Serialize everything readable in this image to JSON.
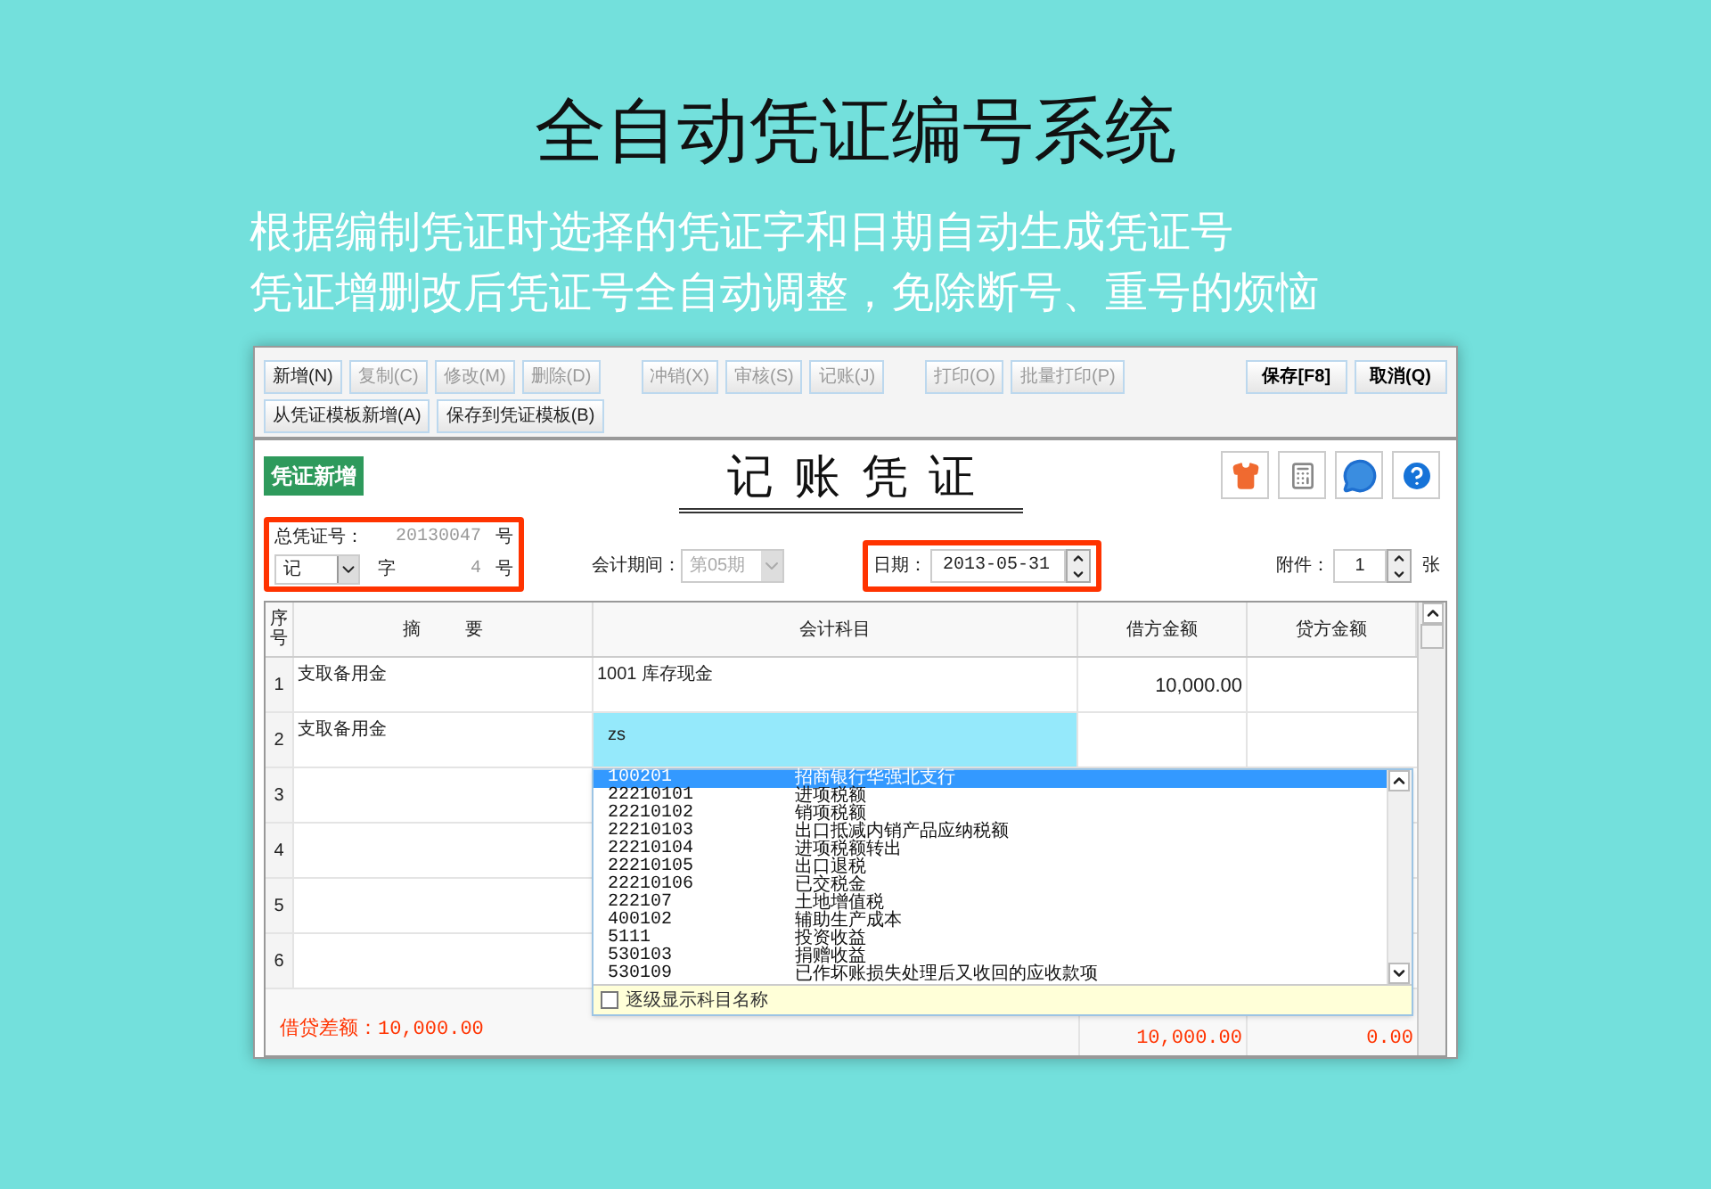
{
  "headline": "全自动凭证编号系统",
  "subtitle_lines": [
    "根据编制凭证时选择的凭证字和日期自动生成凭证号",
    "凭证增删改后凭证号全自动调整，免除断号、重号的烦恼"
  ],
  "toolbar": {
    "groups": [
      [
        {
          "label": "新增(N)",
          "disabled": false
        },
        {
          "label": "复制(C)",
          "disabled": true
        },
        {
          "label": "修改(M)",
          "disabled": true
        },
        {
          "label": "删除(D)",
          "disabled": true
        }
      ],
      [
        {
          "label": "冲销(X)",
          "disabled": true
        },
        {
          "label": "审核(S)",
          "disabled": true
        },
        {
          "label": "记账(J)",
          "disabled": true
        }
      ],
      [
        {
          "label": "打印(O)",
          "disabled": true
        },
        {
          "label": "批量打印(P)",
          "disabled": true
        }
      ]
    ],
    "right_buttons": [
      "保存[F8]",
      "取消(Q)"
    ],
    "second_row": [
      {
        "label": "从凭证模板新增(A)",
        "disabled": false
      },
      {
        "label": "保存到凭证模板(B)",
        "disabled": false
      }
    ]
  },
  "voucher": {
    "badge": "凭证新增",
    "title": "记账凭证",
    "total_no_label": "总凭证号：",
    "total_no": "20130047",
    "total_no_suffix": "号",
    "word": "记",
    "word_label": "字",
    "number": "4",
    "number_suffix": "号",
    "period_label": "会计期间：",
    "period": "第05期",
    "period_disabled": true,
    "date_label": "日期：",
    "date": "2013-05-31",
    "attach_label": "附件：",
    "attach": "1",
    "attach_suffix": "张"
  },
  "table": {
    "columns": [
      "序号",
      "摘要",
      "会计科目",
      "借方金额",
      "贷方金额"
    ],
    "rows": [
      {
        "index": "1",
        "summary": "支取备用金",
        "account": "1001 库存现金",
        "debit": "10,000.00",
        "kind": "entry"
      },
      {
        "index": "2",
        "summary": "支取备用金",
        "account": "zs",
        "kind": "input"
      },
      {
        "index": "3",
        "kind": "entry"
      },
      {
        "index": "4",
        "kind": "entry"
      },
      {
        "index": "5",
        "kind": "entry"
      },
      {
        "index": "6",
        "kind": "entry"
      }
    ],
    "difference": "借贷差额：10,000.00",
    "debit_total": "10,000.00",
    "credit_total": "0.00"
  },
  "dropdown": {
    "items": [
      {
        "code": "100201",
        "name": "招商银行华强北支行",
        "selected": true
      },
      {
        "code": "22210101",
        "name": "进项税额",
        "selected": false
      },
      {
        "code": "22210102",
        "name": "销项税额",
        "selected": false
      },
      {
        "code": "22210103",
        "name": "出口抵减内销产品应纳税额",
        "selected": false
      },
      {
        "code": "22210104",
        "name": "进项税额转出",
        "selected": false
      },
      {
        "code": "22210105",
        "name": "出口退税",
        "selected": false
      },
      {
        "code": "22210106",
        "name": "已交税金",
        "selected": false
      },
      {
        "code": "222107",
        "name": "土地增值税",
        "selected": false
      },
      {
        "code": "400102",
        "name": "辅助生产成本",
        "selected": false
      },
      {
        "code": "5111",
        "name": "投资收益",
        "selected": false
      },
      {
        "code": "530103",
        "name": "捐赠收益",
        "selected": false
      },
      {
        "code": "530109",
        "name": "已作坏账损失处理后又收回的应收款项",
        "selected": false
      }
    ],
    "checkbox": {
      "label": "逐级显示科目名称",
      "checked": false
    }
  }
}
